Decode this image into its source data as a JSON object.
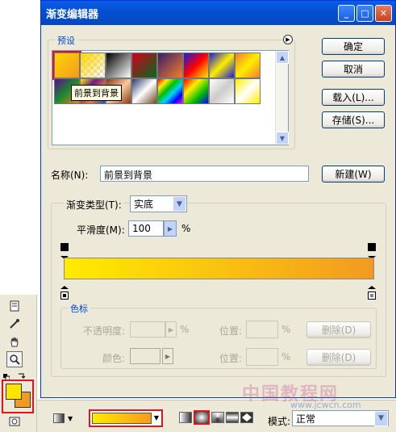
{
  "dialog": {
    "title": "渐变编辑器",
    "presets_label": "预设",
    "ok": "确定",
    "cancel": "取消",
    "load": "载入(L)...",
    "save": "存储(S)...",
    "tooltip": "前景到背景",
    "name_label": "名称(N):",
    "name_value": "前景到背景",
    "new_button": "新建(W)",
    "gradient_type_label": "渐变类型(T):",
    "gradient_type_value": "实底",
    "smoothness_label": "平滑度(M):",
    "smoothness_value": "100",
    "percent": "%",
    "color_stops_label": "色标",
    "opacity_label": "不透明度:",
    "location_label": "位置:",
    "delete_label": "删除(D)",
    "color_label": "颜色:"
  },
  "presets": [
    {
      "name": "foreground-to-background",
      "colors": [
        "#ffd500",
        "#f39a20"
      ],
      "selected": true
    },
    {
      "name": "foreground-to-transparent",
      "colors": [
        "#ffd500",
        "transparent"
      ]
    },
    {
      "name": "black-white",
      "colors": [
        "#000000",
        "#ffffff"
      ]
    },
    {
      "name": "red-green",
      "colors": [
        "#d4001b",
        "#006a20"
      ]
    },
    {
      "name": "violet-orange",
      "colors": [
        "#3a1d6a",
        "#f07f2a"
      ]
    },
    {
      "name": "blue-red-yellow",
      "colors": [
        "#1a1ad8",
        "#ff0000",
        "#ffee00"
      ]
    },
    {
      "name": "blue-yellow-blue",
      "colors": [
        "#1a1ad8",
        "#ffee00",
        "#1a1ad8"
      ]
    },
    {
      "name": "orange-yellow-orange",
      "colors": [
        "#f07f2a",
        "#ffee00",
        "#f07f2a"
      ]
    },
    {
      "name": "violet-green-orange",
      "colors": [
        "#5a0d8a",
        "#1b8a2e",
        "#f07f2a"
      ]
    },
    {
      "name": "yellow-violet-orange-blue",
      "colors": [
        "#ffee00",
        "#6a1a8a",
        "#f07f2a",
        "#1a4ad8"
      ]
    },
    {
      "name": "copper",
      "colors": [
        "#8a3a10",
        "#f7c9a0",
        "#8a3a10"
      ]
    },
    {
      "name": "chrome",
      "colors": [
        "#2a3a6a",
        "#ffffff",
        "#6a4a20"
      ]
    },
    {
      "name": "spectrum",
      "colors": [
        "#ff0000",
        "#ffee00",
        "#00c000",
        "#00d0ff",
        "#0000ff",
        "#ff00ff"
      ]
    },
    {
      "name": "transparent-rainbow",
      "colors": [
        "#ff0000",
        "#ffee00",
        "#00c000",
        "#0000ff"
      ]
    },
    {
      "name": "transparent-stripes",
      "colors": [
        "#ffffff",
        "#cccccc",
        "#ffffff"
      ]
    },
    {
      "name": "checker-yellow",
      "colors": [
        "#ffee00",
        "#ffffff",
        "#ffee00"
      ]
    }
  ],
  "optbar": {
    "mode_label": "模式:",
    "mode_value": "正常"
  },
  "watermark": {
    "text": "中国教程网",
    "url": "www.jcwcn.com"
  },
  "colors": {
    "foreground": "#ffe400",
    "background": "#f39a20",
    "highlight": "#e0151b"
  }
}
